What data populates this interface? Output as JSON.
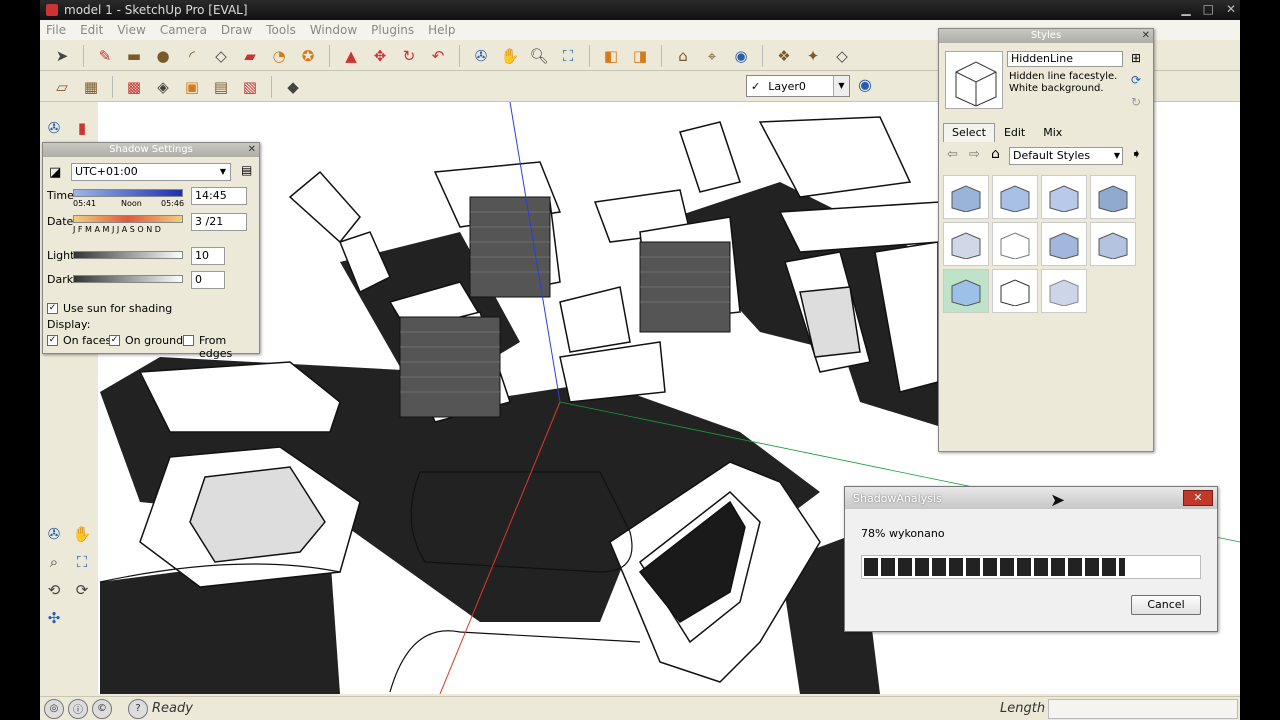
{
  "window": {
    "title": "model 1 - SketchUp Pro [EVAL]"
  },
  "menu": [
    "File",
    "Edit",
    "View",
    "Camera",
    "Draw",
    "Tools",
    "Window",
    "Plugins",
    "Help"
  ],
  "layer": {
    "check": "✓",
    "name": "Layer0"
  },
  "shadow_settings": {
    "title": "Shadow Settings",
    "timezone": "UTC+01:00",
    "time_label": "Time",
    "time_start": "05:41",
    "time_noon": "Noon",
    "time_end": "05:46",
    "time_value": "14:45",
    "date_label": "Date",
    "months": "J F M A M J J A S O N D",
    "date_value": "3 /21",
    "light_label": "Light",
    "light_value": "10",
    "dark_label": "Dark",
    "dark_value": "0",
    "use_sun_label": "Use sun for shading",
    "display_label": "Display:",
    "on_faces": "On faces",
    "on_ground": "On ground",
    "from_edges": "From edges"
  },
  "styles": {
    "title": "Styles",
    "style_name": "HiddenLine",
    "description": "Hidden line facestyle. White background.",
    "tabs": [
      "Select",
      "Edit",
      "Mix"
    ],
    "library": "Default Styles"
  },
  "progress": {
    "title": "ShadowAnalysis",
    "text": "78% wykonano",
    "percent": 78,
    "cancel": "Cancel"
  },
  "status": {
    "ready": "Ready",
    "length_label": "Length"
  }
}
